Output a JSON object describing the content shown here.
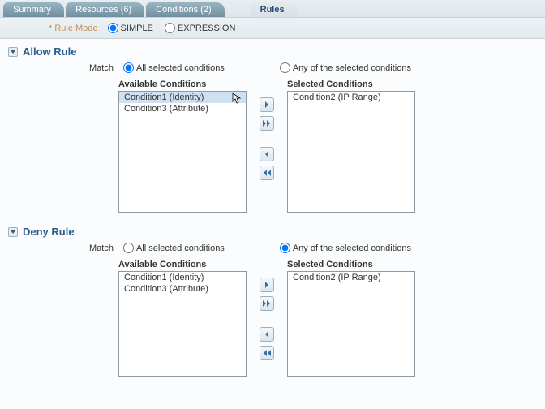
{
  "tabs": {
    "summary": "Summary",
    "resources": "Resources (6)",
    "conditions": "Conditions (2)",
    "rules": "Rules"
  },
  "rule_mode": {
    "label": "* Rule Mode",
    "simple": "SIMPLE",
    "expression": "EXPRESSION"
  },
  "allow": {
    "title": "Allow Rule",
    "match_label": "Match",
    "opt_all": "All selected conditions",
    "opt_any": "Any of the selected conditions",
    "available_label": "Available Conditions",
    "selected_label": "Selected Conditions",
    "available": [
      "Condition1 (Identity)",
      "Condition3 (Attribute)"
    ],
    "selected": [
      "Condition2 (IP Range)"
    ]
  },
  "deny": {
    "title": "Deny Rule",
    "match_label": "Match",
    "opt_all": "All selected conditions",
    "opt_any": "Any of the selected conditions",
    "available_label": "Available Conditions",
    "selected_label": "Selected Conditions",
    "available": [
      "Condition1 (Identity)",
      "Condition3 (Attribute)"
    ],
    "selected": [
      "Condition2 (IP Range)"
    ]
  }
}
